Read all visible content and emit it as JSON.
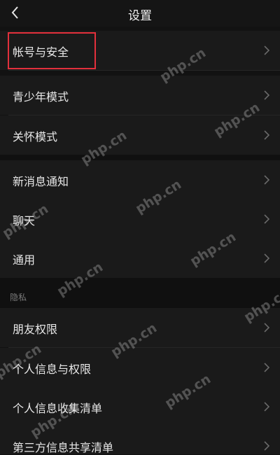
{
  "header": {
    "title": "设置"
  },
  "sections": {
    "privacy_label": "隐私"
  },
  "items": [
    {
      "label": "帐号与安全"
    },
    {
      "label": "青少年模式"
    },
    {
      "label": "关怀模式"
    },
    {
      "label": "新消息通知"
    },
    {
      "label": "聊天"
    },
    {
      "label": "通用"
    },
    {
      "label": "朋友权限"
    },
    {
      "label": "个人信息与权限"
    },
    {
      "label": "个人信息收集清单"
    },
    {
      "label": "第三方信息共享清单"
    }
  ],
  "watermark": "php.cn",
  "colors": {
    "highlight_box": "#e3303c",
    "background": "#121212",
    "row_background": "#1a1a1a"
  }
}
